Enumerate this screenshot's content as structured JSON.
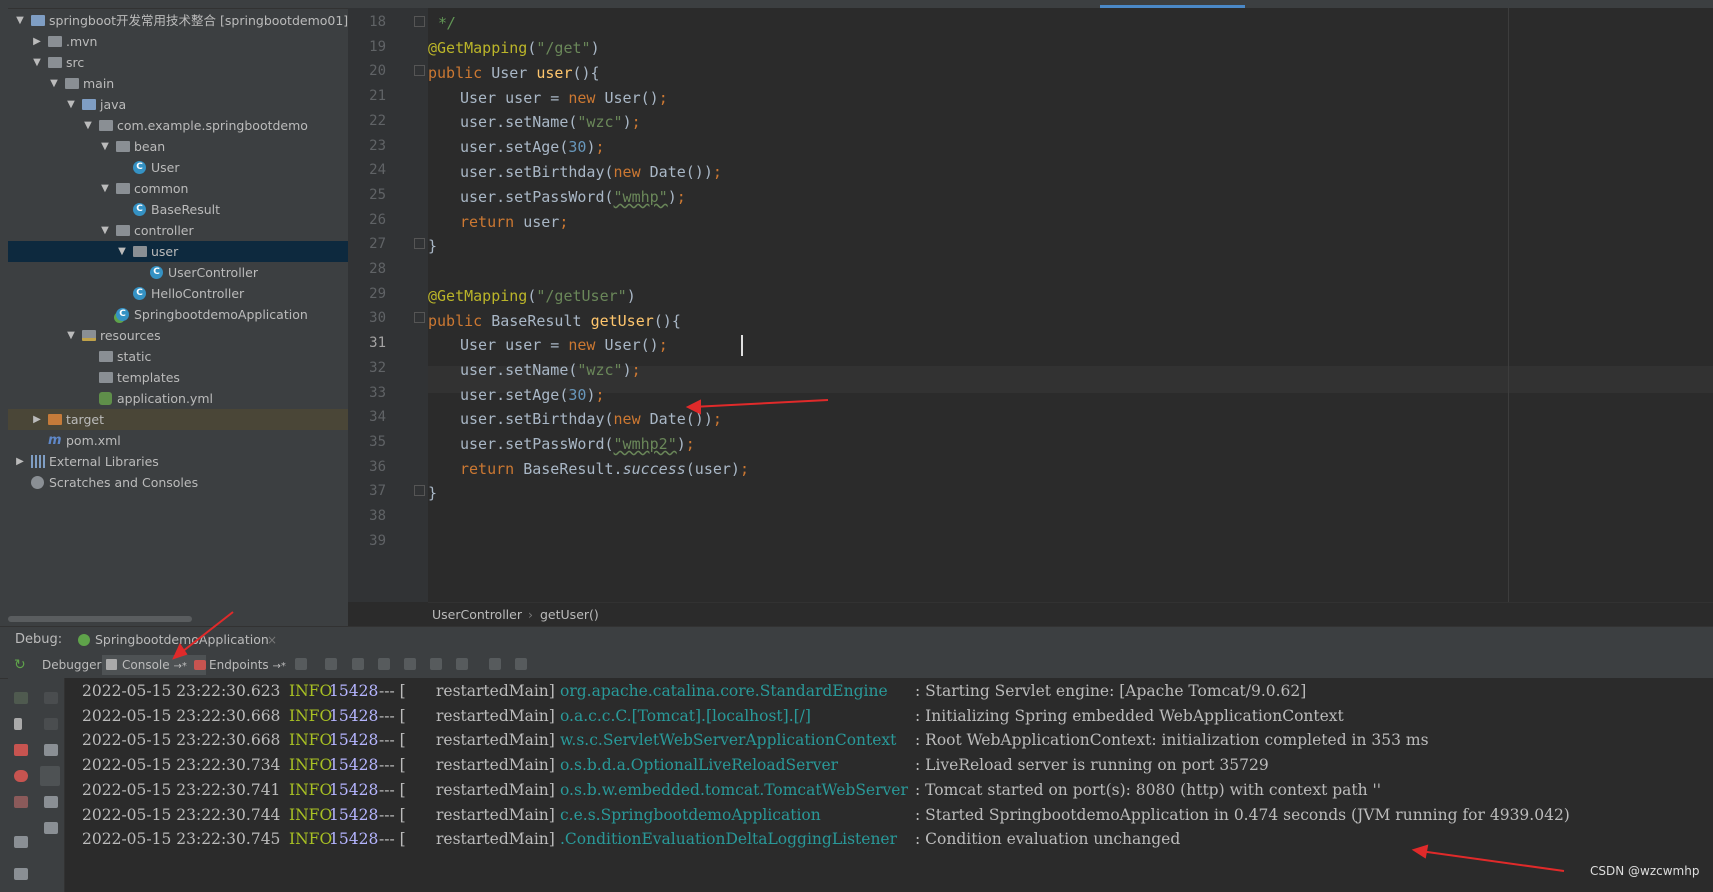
{
  "project_tree": [
    {
      "indent": 0,
      "arrow": "▼",
      "icon": "folder-blue",
      "label": "springboot开发常用技术整合 [springbootdemo01]"
    },
    {
      "indent": 1,
      "arrow": "▶",
      "icon": "folder",
      "label": ".mvn"
    },
    {
      "indent": 1,
      "arrow": "▼",
      "icon": "folder",
      "label": "src"
    },
    {
      "indent": 2,
      "arrow": "▼",
      "icon": "folder",
      "label": "main"
    },
    {
      "indent": 3,
      "arrow": "▼",
      "icon": "folder-blue",
      "label": "java"
    },
    {
      "indent": 4,
      "arrow": "▼",
      "icon": "package",
      "label": "com.example.springbootdemo"
    },
    {
      "indent": 5,
      "arrow": "▼",
      "icon": "package",
      "label": "bean"
    },
    {
      "indent": 6,
      "arrow": "",
      "icon": "class",
      "label": "User"
    },
    {
      "indent": 5,
      "arrow": "▼",
      "icon": "package",
      "label": "common"
    },
    {
      "indent": 6,
      "arrow": "",
      "icon": "class",
      "label": "BaseResult"
    },
    {
      "indent": 5,
      "arrow": "▼",
      "icon": "package",
      "label": "controller"
    },
    {
      "indent": 6,
      "arrow": "▼",
      "icon": "package",
      "label": "user",
      "selected": true
    },
    {
      "indent": 7,
      "arrow": "",
      "icon": "class",
      "label": "UserController"
    },
    {
      "indent": 6,
      "arrow": "",
      "icon": "class",
      "label": "HelloController"
    },
    {
      "indent": 5,
      "arrow": "",
      "icon": "app",
      "label": "SpringbootdemoApplication"
    },
    {
      "indent": 3,
      "arrow": "▼",
      "icon": "folder-res",
      "label": "resources"
    },
    {
      "indent": 4,
      "arrow": "",
      "icon": "folder",
      "label": "static"
    },
    {
      "indent": 4,
      "arrow": "",
      "icon": "folder",
      "label": "templates"
    },
    {
      "indent": 4,
      "arrow": "",
      "icon": "yml",
      "label": "application.yml"
    },
    {
      "indent": 1,
      "arrow": "▶",
      "icon": "folder-orange",
      "label": "target",
      "excluded": true
    },
    {
      "indent": 1,
      "arrow": "",
      "icon": "maven",
      "label": "pom.xml"
    },
    {
      "indent": 0,
      "arrow": "▶",
      "icon": "libs",
      "label": "External Libraries"
    },
    {
      "indent": 0,
      "arrow": "",
      "icon": "scratch",
      "label": "Scratches and Consoles"
    }
  ],
  "editor": {
    "current_line": "31",
    "lines": [
      {
        "n": "18",
        "html_key": "l18"
      },
      {
        "n": "19"
      },
      {
        "n": "20"
      },
      {
        "n": "21"
      },
      {
        "n": "22"
      },
      {
        "n": "23"
      },
      {
        "n": "24"
      },
      {
        "n": "25"
      },
      {
        "n": "26"
      },
      {
        "n": "27"
      },
      {
        "n": "28"
      },
      {
        "n": "29"
      },
      {
        "n": "30"
      },
      {
        "n": "31"
      },
      {
        "n": "32"
      },
      {
        "n": "33"
      },
      {
        "n": "34"
      },
      {
        "n": "35"
      },
      {
        "n": "36"
      },
      {
        "n": "37"
      },
      {
        "n": "38"
      },
      {
        "n": "39"
      }
    ],
    "code": {
      "l18": "*/",
      "get_mapping_1": "@GetMapping",
      "path_get": "\"/get\"",
      "kw_public": "public",
      "type_user": "User",
      "method_user": "user",
      "user_decl": "User user = ",
      "kw_new": "new",
      "ctor_user": "User()",
      "set_name": "user.setName(",
      "str_wzc": "\"wzc\"",
      "set_age": "user.setAge(",
      "num_30": "30",
      "set_birthday": "user.setBirthday(",
      "ctor_date": "Date()",
      "set_password": "user.setPassWord(",
      "str_wmhp": "\"wmhp\"",
      "kw_return": "return",
      "ret_user": "user",
      "close_brace": "}",
      "get_mapping_2": "@GetMapping",
      "path_getuser": "\"/getUser\"",
      "type_baseresult": "BaseResult",
      "method_getuser": "getUser",
      "str_wmhp2": "\"wmhp2\"",
      "ret_base": "BaseResult.",
      "success": "success",
      "ret_arg": "(user)"
    }
  },
  "breadcrumb": {
    "class": "UserController",
    "separator": "›",
    "method": "getUser()"
  },
  "debug": {
    "label": "Debug:",
    "session": "SpringbootdemoApplication",
    "tabs": {
      "debugger": "Debugger",
      "console": "Console",
      "endpoints": "Endpoints"
    }
  },
  "console_lines": [
    {
      "ts": "2022-05-15 23:22:30.623",
      "level": "INFO",
      "pid": "15428",
      "sep": "--- [",
      "thread": "restartedMain]",
      "logger": "org.apache.catalina.core.StandardEngine",
      "msg": ": Starting Servlet engine: [Apache Tomcat/9.0.62]"
    },
    {
      "ts": "2022-05-15 23:22:30.668",
      "level": "INFO",
      "pid": "15428",
      "sep": "--- [",
      "thread": "restartedMain]",
      "logger": "o.a.c.c.C.[Tomcat].[localhost].[/]",
      "msg": ": Initializing Spring embedded WebApplicationContext"
    },
    {
      "ts": "2022-05-15 23:22:30.668",
      "level": "INFO",
      "pid": "15428",
      "sep": "--- [",
      "thread": "restartedMain]",
      "logger": "w.s.c.ServletWebServerApplicationContext",
      "msg": ": Root WebApplicationContext: initialization completed in 353 ms"
    },
    {
      "ts": "2022-05-15 23:22:30.734",
      "level": "INFO",
      "pid": "15428",
      "sep": "--- [",
      "thread": "restartedMain]",
      "logger": "o.s.b.d.a.OptionalLiveReloadServer",
      "msg": ": LiveReload server is running on port 35729"
    },
    {
      "ts": "2022-05-15 23:22:30.741",
      "level": "INFO",
      "pid": "15428",
      "sep": "--- [",
      "thread": "restartedMain]",
      "logger": "o.s.b.w.embedded.tomcat.TomcatWebServer",
      "msg": ": Tomcat started on port(s): 8080 (http) with context path ''"
    },
    {
      "ts": "2022-05-15 23:22:30.744",
      "level": "INFO",
      "pid": "15428",
      "sep": "--- [",
      "thread": "restartedMain]",
      "logger": "c.e.s.SpringbootdemoApplication",
      "msg": ": Started SpringbootdemoApplication in 0.474 seconds (JVM running for 4939.042)"
    },
    {
      "ts": "2022-05-15 23:22:30.745",
      "level": "INFO",
      "pid": "15428",
      "sep": "--- [",
      "thread": "restartedMain]",
      "logger": ".ConditionEvaluationDeltaLoggingListener",
      "msg": ": Condition evaluation unchanged"
    }
  ],
  "watermark": "CSDN @wzcwmhp",
  "colors": {
    "accent": "#4a88c7",
    "annotation_arrow": "#e02a2a",
    "selected_row": "#0d293e"
  }
}
